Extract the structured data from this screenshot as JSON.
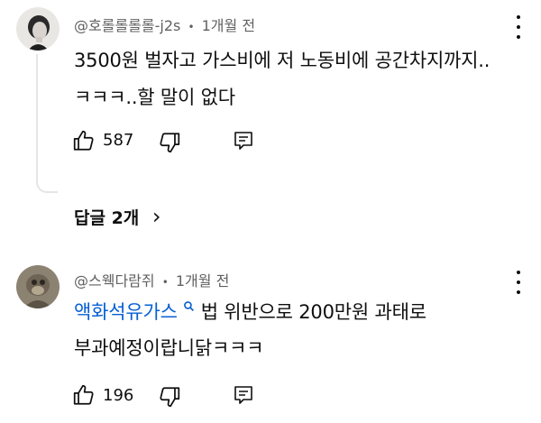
{
  "comments": [
    {
      "author": "@호롤롤롤롤-j2s",
      "separator": "•",
      "time": "1개월 전",
      "lines": [
        "3500원 벌자고 가스비에 저 노동비에 공간차지까지..",
        "ㅋㅋㅋ..할 말이 없다"
      ],
      "likes": "587",
      "replies_label": "답글 2개",
      "replies_chevron": "›"
    },
    {
      "author": "@스웩다람쥐",
      "separator": "•",
      "time": "1개월 전",
      "link_text": "액화석유가스",
      "link_icon": "search-icon",
      "line1_rest": "법 위반으로 200만원 과태로",
      "line2": "부과예정이랍니닭ㅋㅋㅋ",
      "likes": "196"
    }
  ],
  "icons": {
    "like": "thumbs-up-icon",
    "dislike": "thumbs-down-icon",
    "reply": "reply-icon",
    "menu": "more-vert-icon"
  },
  "colors": {
    "text": "#0f0f0f",
    "secondary": "#606060",
    "link": "#065fd4",
    "thread_line": "#e5e5e5"
  }
}
